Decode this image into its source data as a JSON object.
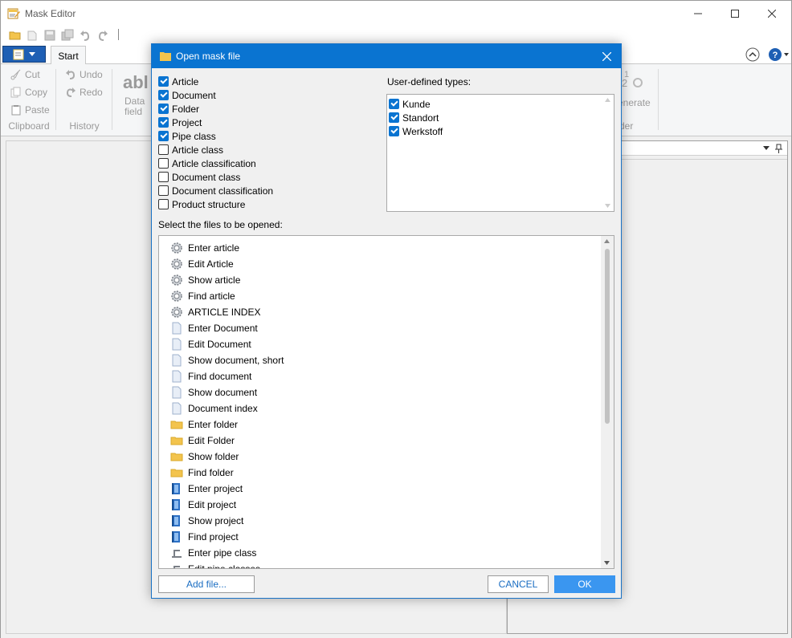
{
  "window": {
    "title": "Mask Editor"
  },
  "ribbon": {
    "tabs": [
      "Start"
    ],
    "clipboard": {
      "cut": "Cut",
      "copy": "Copy",
      "paste": "Paste",
      "label": "Clipboard"
    },
    "history": {
      "undo": "Undo",
      "redo": "Redo",
      "label": "History"
    },
    "data_field": {
      "icon_text": "abl",
      "line1": "Data",
      "line2": "field"
    },
    "generate": {
      "label": "enerate",
      "group_label": "der"
    }
  },
  "dialog": {
    "title": "Open mask file",
    "types": [
      {
        "label": "Article",
        "checked": true
      },
      {
        "label": "Document",
        "checked": true
      },
      {
        "label": "Folder",
        "checked": true
      },
      {
        "label": "Project",
        "checked": true
      },
      {
        "label": "Pipe class",
        "checked": true
      },
      {
        "label": "Article class",
        "checked": false
      },
      {
        "label": "Article classification",
        "checked": false
      },
      {
        "label": "Document class",
        "checked": false
      },
      {
        "label": "Document classification",
        "checked": false
      },
      {
        "label": "Product structure",
        "checked": false
      }
    ],
    "user_defined_label": "User-defined types:",
    "user_defined": [
      {
        "label": "Kunde",
        "checked": true
      },
      {
        "label": "Standort",
        "checked": true
      },
      {
        "label": "Werkstoff",
        "checked": true
      }
    ],
    "files_label": "Select the files to be opened:",
    "files": [
      {
        "label": "Enter article",
        "icon": "gear-icon"
      },
      {
        "label": "Edit Article",
        "icon": "gear-icon"
      },
      {
        "label": "Show article",
        "icon": "gear-icon"
      },
      {
        "label": "Find article",
        "icon": "gear-icon"
      },
      {
        "label": "ARTICLE INDEX",
        "icon": "gear-icon"
      },
      {
        "label": "Enter Document",
        "icon": "document-icon"
      },
      {
        "label": "Edit Document",
        "icon": "document-icon"
      },
      {
        "label": "Show document, short",
        "icon": "document-icon"
      },
      {
        "label": "Find document",
        "icon": "document-icon"
      },
      {
        "label": "Show document",
        "icon": "document-icon"
      },
      {
        "label": "Document index",
        "icon": "document-icon"
      },
      {
        "label": "Enter folder",
        "icon": "folder-icon"
      },
      {
        "label": "Edit Folder",
        "icon": "folder-icon"
      },
      {
        "label": "Show folder",
        "icon": "folder-icon"
      },
      {
        "label": "Find folder",
        "icon": "folder-icon"
      },
      {
        "label": "Enter project",
        "icon": "project-icon"
      },
      {
        "label": "Edit project",
        "icon": "project-icon"
      },
      {
        "label": "Show project",
        "icon": "project-icon"
      },
      {
        "label": "Find project",
        "icon": "project-icon"
      },
      {
        "label": "Enter pipe class",
        "icon": "pipe-icon"
      },
      {
        "label": "Edit pipe classes",
        "icon": "pipe-icon"
      }
    ],
    "add_file": "Add file...",
    "cancel": "CANCEL",
    "ok": "OK"
  },
  "colors": {
    "accent": "#0a74d1",
    "ok_button": "#3a96f0"
  }
}
